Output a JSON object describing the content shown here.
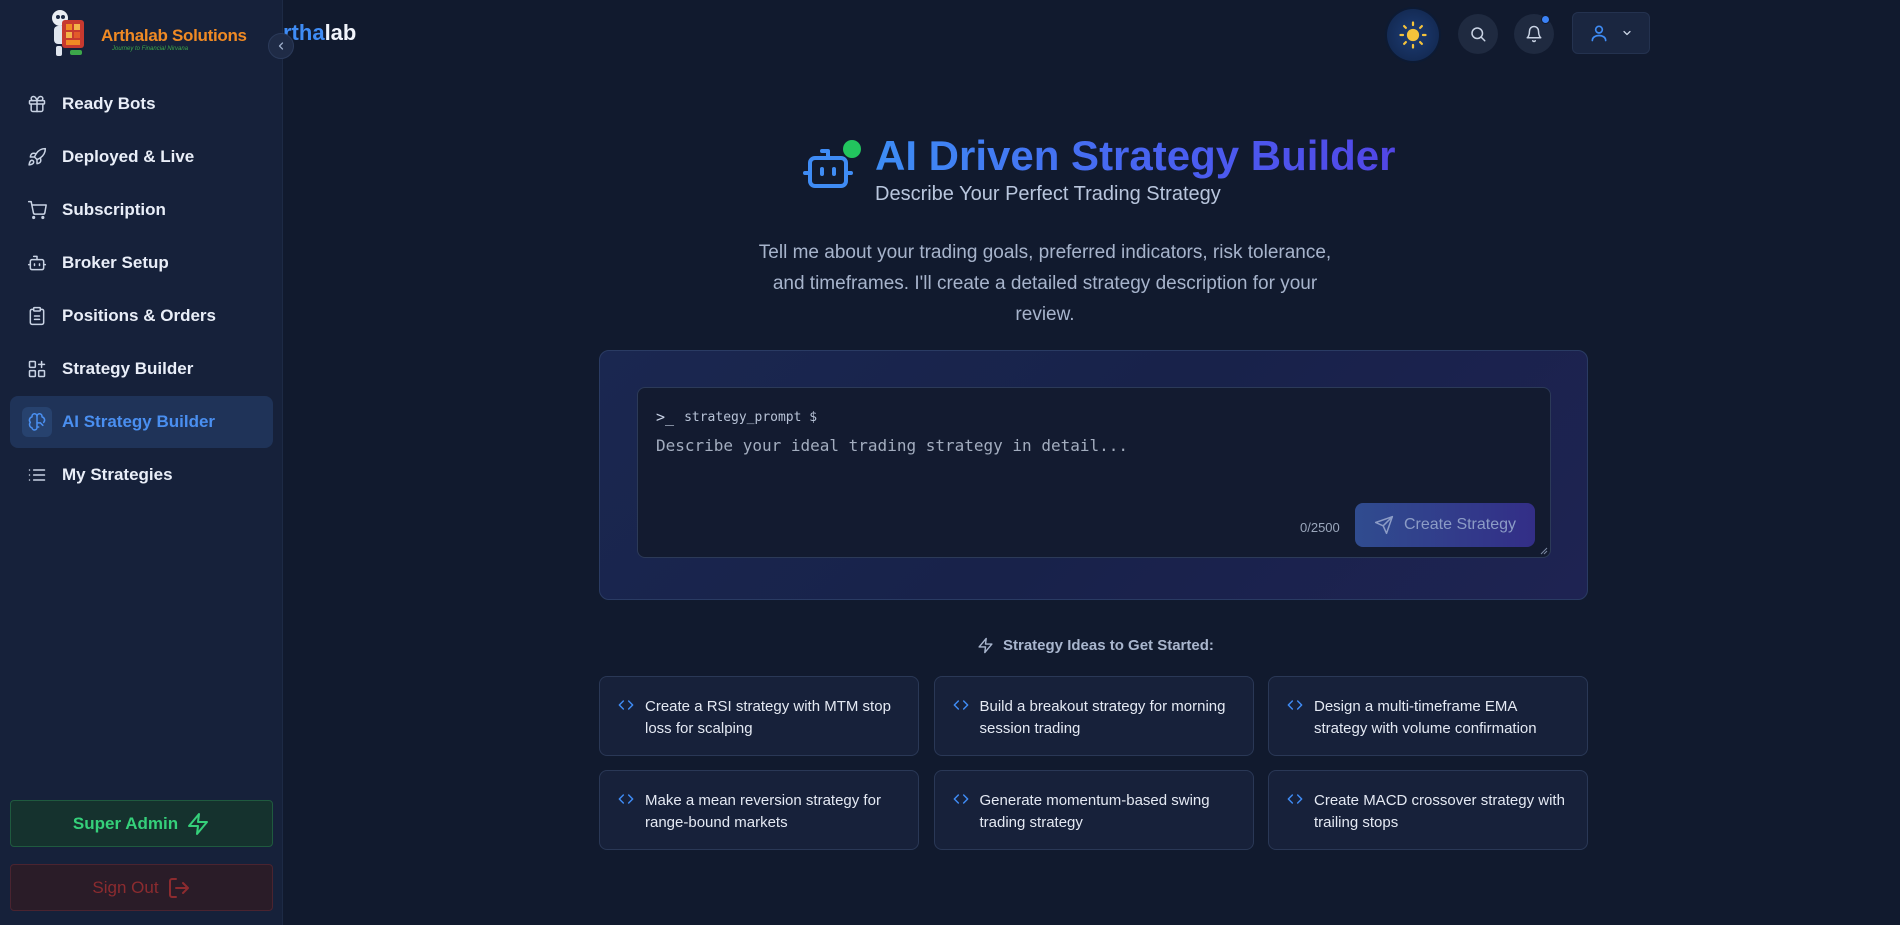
{
  "brand": {
    "logo_title": "Arthalab Solutions",
    "logo_tagline": "Journey to Financial Nirvana",
    "header_brand_part1": "rtha",
    "header_brand_part2": "lab"
  },
  "sidebar": {
    "items": [
      {
        "label": "Ready Bots",
        "icon": "gift-icon"
      },
      {
        "label": "Deployed & Live",
        "icon": "rocket-icon"
      },
      {
        "label": "Subscription",
        "icon": "cart-icon"
      },
      {
        "label": "Broker Setup",
        "icon": "bot-icon"
      },
      {
        "label": "Positions & Orders",
        "icon": "clipboard-icon"
      },
      {
        "label": "Strategy Builder",
        "icon": "grid-plus-icon"
      },
      {
        "label": "AI Strategy Builder",
        "icon": "brain-icon",
        "active": true
      },
      {
        "label": "My Strategies",
        "icon": "list-icon"
      }
    ],
    "super_admin_label": "Super Admin",
    "sign_out_label": "Sign Out"
  },
  "header": {
    "icons": [
      "theme-toggle-icon",
      "search-icon",
      "bell-icon",
      "user-icon",
      "chevron-down-icon"
    ],
    "has_notification": true
  },
  "hero": {
    "title": "AI Driven Strategy Builder",
    "subtitle": "Describe Your Perfect Trading Strategy",
    "description": "Tell me about your trading goals, preferred indicators, risk tolerance, and timeframes. I'll create a detailed strategy description for your review."
  },
  "prompt": {
    "terminal_symbol": ">_",
    "label": "strategy_prompt $",
    "placeholder": "Describe your ideal trading strategy in detail...",
    "value": "",
    "char_count": "0/2500",
    "submit_label": "Create Strategy"
  },
  "ideas": {
    "heading": "Strategy Ideas to Get Started:",
    "items": [
      "Create a RSI strategy with MTM stop loss for scalping",
      "Build a breakout strategy for morning session trading",
      "Design a multi-timeframe EMA strategy with volume confirmation",
      "Make a mean reversion strategy for range-bound markets",
      "Generate momentum-based swing trading strategy",
      "Create MACD crossover strategy with trailing stops"
    ]
  },
  "colors": {
    "accent": "#3f8cf5",
    "success": "#35d07a",
    "danger": "#8c2b2f",
    "background": "#111a2e",
    "sidebar": "#16213a"
  }
}
